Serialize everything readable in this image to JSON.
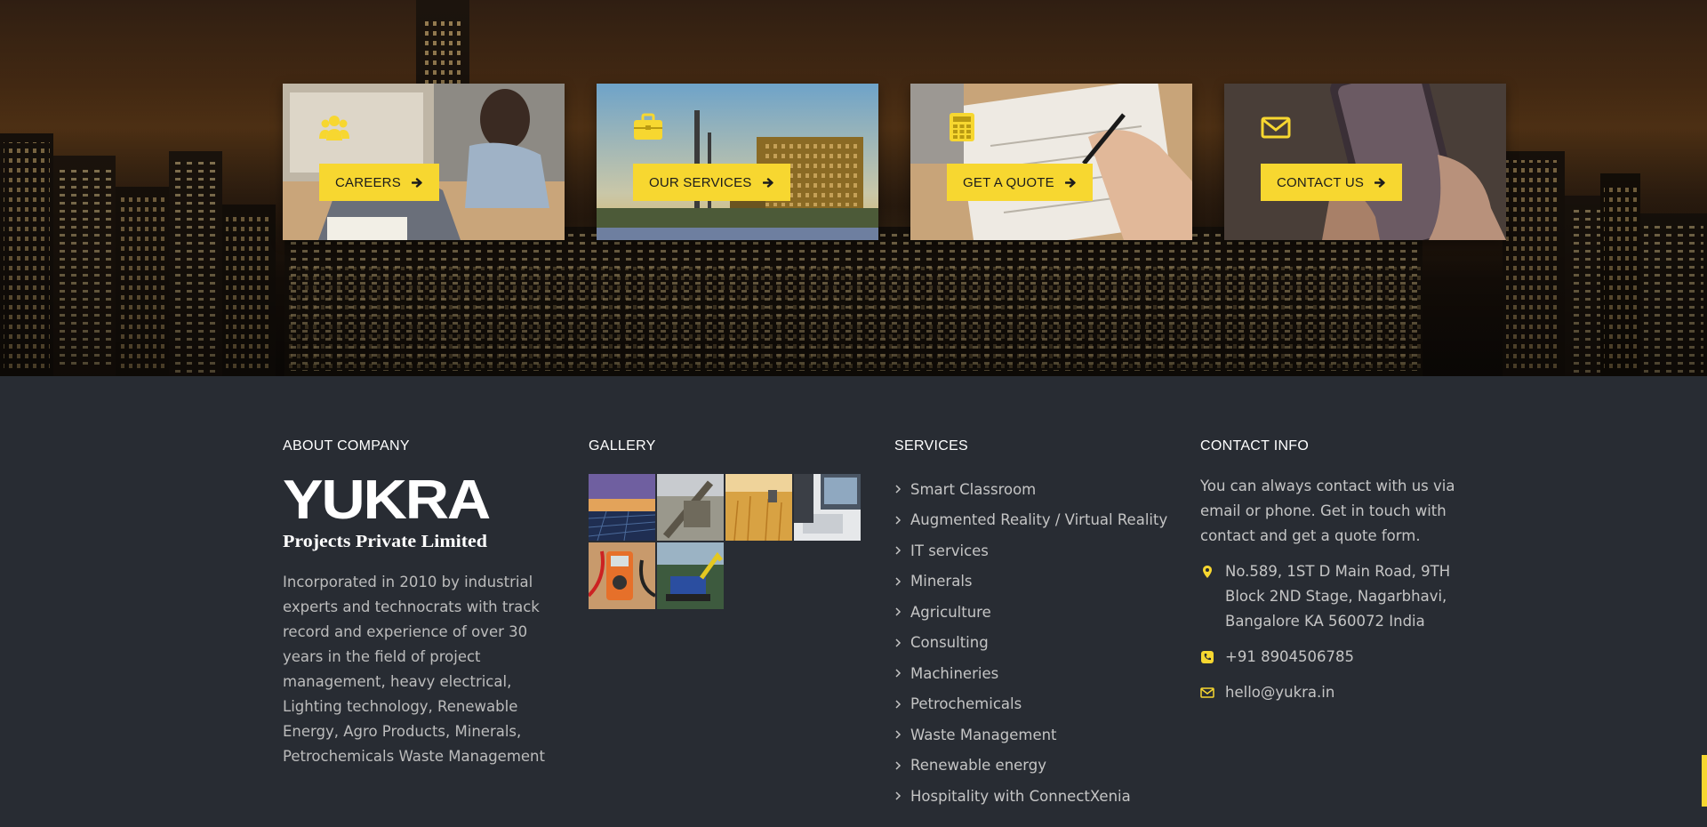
{
  "colors": {
    "accent": "#f7d730",
    "footer_bg": "#282c33",
    "heading": "#ffffff",
    "text": "#c5c5c5"
  },
  "hero": {
    "cards": [
      {
        "label": "CAREERS",
        "icon": "users-icon",
        "arrow": "arrow-right-icon"
      },
      {
        "label": "OUR SERVICES",
        "icon": "briefcase-icon",
        "arrow": "arrow-right-icon"
      },
      {
        "label": "GET A QUOTE",
        "icon": "calculator-icon",
        "arrow": "arrow-right-icon"
      },
      {
        "label": "CONTACT US",
        "icon": "envelope-icon",
        "arrow": "arrow-right-icon"
      }
    ]
  },
  "footer": {
    "about": {
      "heading": "ABOUT COMPANY",
      "logo_text": "YUKRA",
      "logo_sub": "Projects Private Limited",
      "description": "Incorporated in 2010 by industrial experts and technocrats with track record and experience of over 30 years in the field of project management, heavy electrical, Lighting technology, Renewable Energy, Agro Products, Minerals, Petrochemicals Waste Management"
    },
    "gallery": {
      "heading": "GALLERY"
    },
    "services": {
      "heading": "SERVICES",
      "items": [
        "Smart Classroom",
        "Augmented Reality / Virtual Reality",
        "IT services",
        "Minerals",
        "Agriculture",
        "Consulting",
        "Machineries",
        "Petrochemicals",
        "Waste Management",
        "Renewable energy",
        "Hospitality with ConnectXenia"
      ]
    },
    "contact": {
      "heading": "CONTACT INFO",
      "intro": "You can always contact with us via email or phone. Get in touch with contact and get a quote form.",
      "address": "No.589, 1ST D Main Road, 9TH Block 2ND Stage, Nagarbhavi, Bangalore KA 560072 India",
      "phone": "+91 8904506785",
      "email": "hello@yukra.in"
    }
  }
}
